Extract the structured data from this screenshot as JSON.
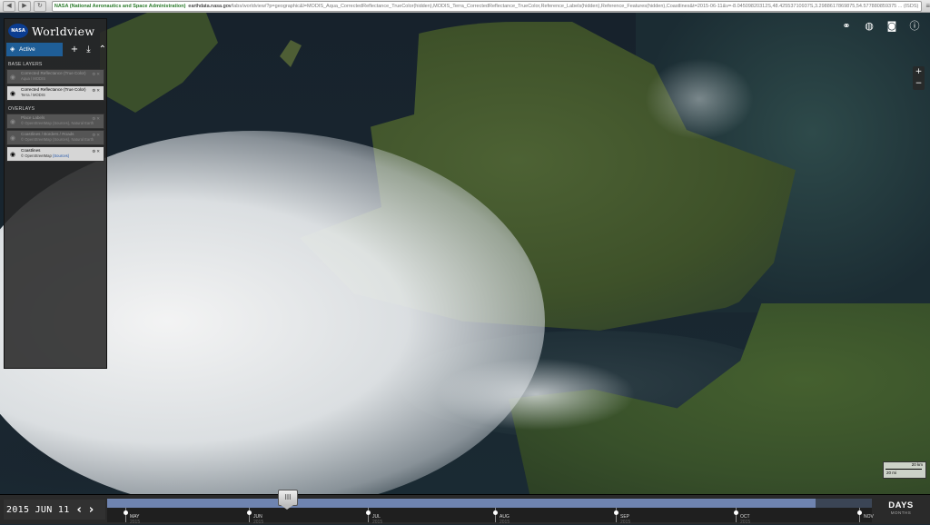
{
  "browser": {
    "back": "◀",
    "forward": "▶",
    "reload": "↻",
    "secure_org": "NASA (National Aeronautics and Space Administration)",
    "domain": "earthdata.nasa.gov",
    "path": "/labs/worldview/?p=geographic&l=MODIS_Aqua_CorrectedReflectance_TrueColor(hidden),MODIS_Terra_CorrectedReflectance_TrueColor,Reference_Labels(hidden),Reference_Features(hidden),Coastlines&t=2015-06-11&v=-8.04509820312S,48.42553710937S,3.2988617869875,54.577880859375 ... (ISDS)",
    "settings": "≡"
  },
  "app": {
    "logo": "NASA",
    "title": "Worldview"
  },
  "panel": {
    "tab_label": "Active",
    "tab_icon": "layers-icon",
    "add_icon": "+",
    "download_icon": "⤓",
    "collapse_icon": "⌃",
    "base_layers_label": "BASE LAYERS",
    "overlays_label": "OVERLAYS",
    "base_layers": [
      {
        "name": "Corrected Reflectance (True Color)",
        "sub": "Aqua / MODIS",
        "active": false
      },
      {
        "name": "Corrected Reflectance (True Color)",
        "sub": "Terra / MODIS",
        "active": true
      }
    ],
    "overlays": [
      {
        "name": "Place Labels",
        "sub": "© OpenStreetMap (Sources), Natural Earth",
        "active": false
      },
      {
        "name": "Coastlines / Borders / Roads",
        "sub": "© OpenStreetMap (Sources), Natural Earth",
        "active": false
      },
      {
        "name": "Coastlines",
        "sub": "© OpenStreetMap ",
        "sub_link": "(Sources)",
        "active": true
      }
    ]
  },
  "toolbar": {
    "link_icon": "link-icon",
    "projection_icon": "globe-icon",
    "camera_icon": "camera-icon",
    "info_icon": "info-icon"
  },
  "zoom": {
    "plus": "+",
    "minus": "−"
  },
  "scale": {
    "km": "20 km",
    "mi": "20 mi"
  },
  "timeline": {
    "date": "2015 JUN 11",
    "prev": "‹",
    "next": "›",
    "handle": "III",
    "zoom_level": "DAYS",
    "zoom_sub": "MONTHS",
    "months": [
      {
        "label": "MAY",
        "year": "2015"
      },
      {
        "label": "JUN",
        "year": "2015"
      },
      {
        "label": "JUL",
        "year": "2015"
      },
      {
        "label": "AUG",
        "year": "2015"
      },
      {
        "label": "SEP",
        "year": "2015"
      },
      {
        "label": "OCT",
        "year": "2015"
      },
      {
        "label": "NOV",
        "year": ""
      }
    ]
  }
}
